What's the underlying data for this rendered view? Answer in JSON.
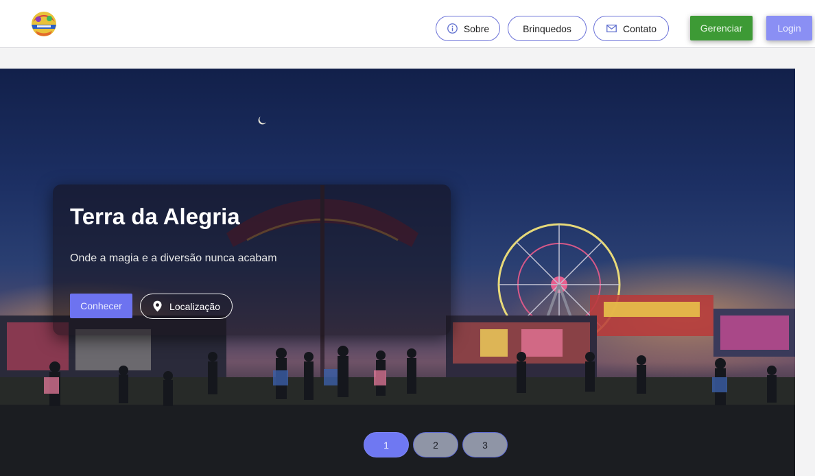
{
  "header": {
    "logo_alt": "logo",
    "nav": {
      "sobre": "Sobre",
      "brinquedos": "Brinquedos",
      "contato": "Contato"
    },
    "gerenciar": "Gerenciar",
    "login": "Login"
  },
  "hero": {
    "title": "Terra da Alegria",
    "subtitle": "Onde a magia e a diversão nunca acabam",
    "conhecer": "Conhecer",
    "localizacao": "Localização"
  },
  "pagination": {
    "pages": [
      "1",
      "2",
      "3"
    ],
    "active": "1"
  },
  "icons": {
    "sobre": "info-icon",
    "contato": "mail-icon",
    "localizacao": "location-pin-icon"
  },
  "colors": {
    "accent": "#6d73f0",
    "success": "#3d9a35",
    "nav_border": "#6b72d8"
  }
}
